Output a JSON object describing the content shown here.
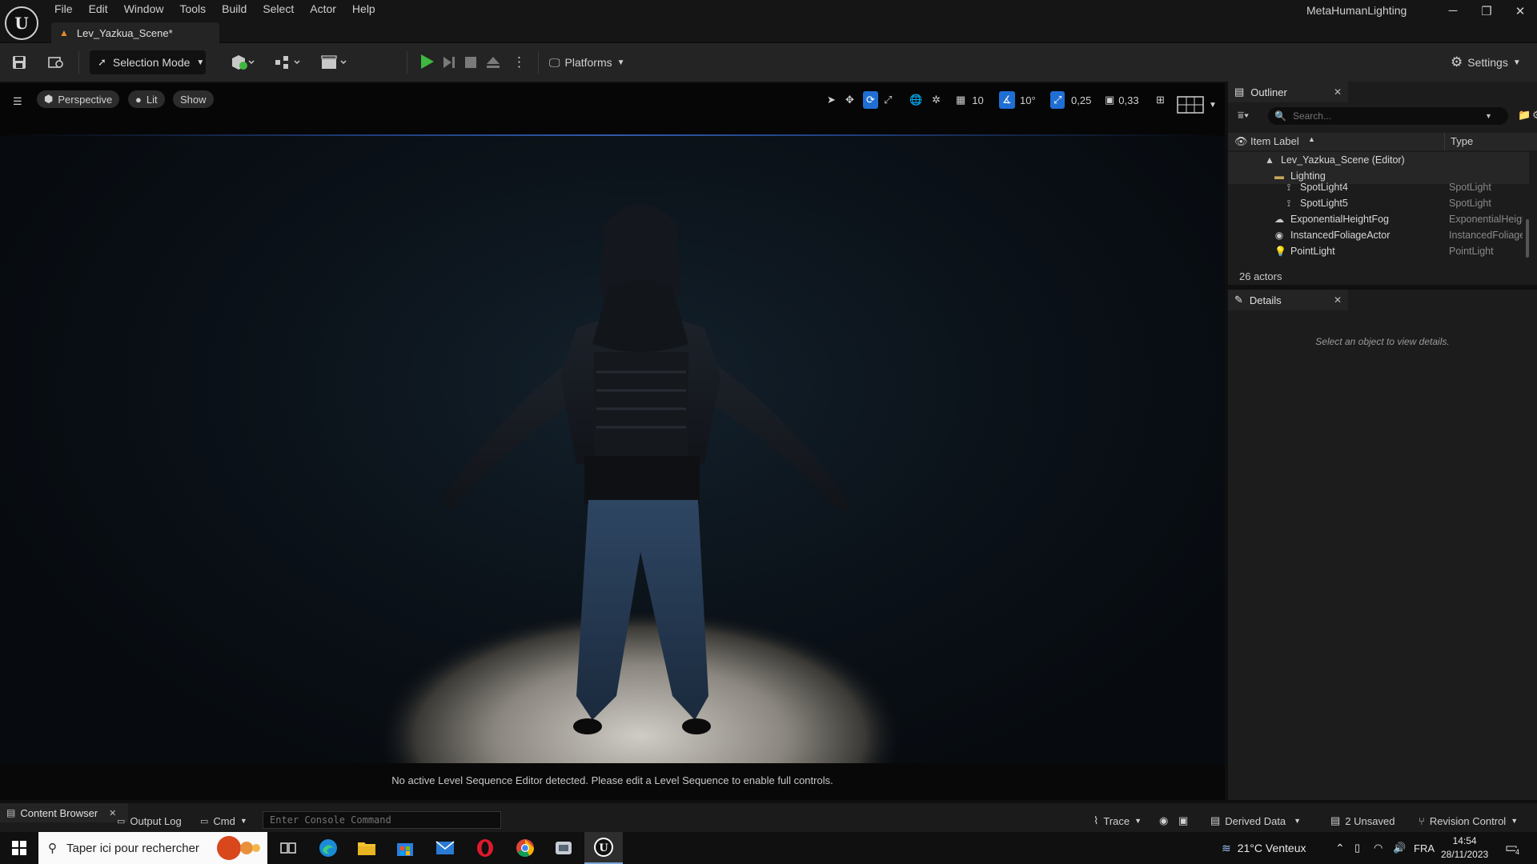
{
  "app": {
    "logo_text": "U",
    "project_name": "MetaHumanLighting",
    "menu": [
      "File",
      "Edit",
      "Window",
      "Tools",
      "Build",
      "Select",
      "Actor",
      "Help"
    ],
    "level_tab": "Lev_Yazkua_Scene*",
    "window_controls": {
      "minimize": "─",
      "restore": "❐",
      "close": "✕"
    }
  },
  "toolbar": {
    "mode_label": "Selection Mode",
    "platforms_label": "Platforms",
    "settings_label": "Settings",
    "play_color": "#3fb83f"
  },
  "viewport": {
    "view_label": "Perspective",
    "lit_label": "Lit",
    "show_label": "Show",
    "grid_snap": "10",
    "rotation_snap": "10°",
    "scale_snap": "0,25",
    "camera_speed": "0,33",
    "sequence_message": "No active Level Sequence Editor detected. Please edit a Level Sequence to enable full controls."
  },
  "outliner": {
    "title": "Outliner",
    "search_placeholder": "Search...",
    "col_label": "Item Label",
    "col_type": "Type",
    "rows": [
      {
        "label": "Lev_Yazkua_Scene (Editor)",
        "type": "",
        "icon": "level-icon"
      },
      {
        "label": "Lighting",
        "type": "",
        "icon": "folder-icon"
      },
      {
        "label": "SpotLight4",
        "type": "SpotLight",
        "icon": "spotlight-icon"
      },
      {
        "label": "SpotLight5",
        "type": "SpotLight",
        "icon": "spotlight-icon"
      },
      {
        "label": "ExponentialHeightFog",
        "type": "ExponentialHeightFog",
        "icon": "fog-icon"
      },
      {
        "label": "InstancedFoliageActor",
        "type": "InstancedFoliageActor",
        "icon": "foliage-icon"
      },
      {
        "label": "PointLight",
        "type": "PointLight",
        "icon": "pointlight-icon"
      }
    ],
    "actor_count": "26 actors"
  },
  "details": {
    "title": "Details",
    "empty_message": "Select an object to view details."
  },
  "statusbar": {
    "content_browser": "Content Browser",
    "output_log": "Output Log",
    "cmd_label": "Cmd",
    "console_placeholder": "Enter Console Command",
    "trace_label": "Trace",
    "derived_data_label": "Derived Data",
    "unsaved_label": "2 Unsaved",
    "revision_label": "Revision Control"
  },
  "taskbar": {
    "search_placeholder": "Taper ici pour rechercher",
    "weather": "21°C Venteux",
    "language": "FRA",
    "time": "14:54",
    "date": "28/11/2023",
    "notification_count": "4"
  }
}
